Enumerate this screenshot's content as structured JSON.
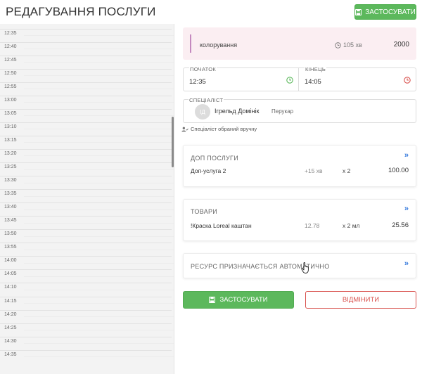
{
  "header": {
    "title": "РЕДАГУВАННЯ ПОСЛУГИ",
    "apply_label": "ЗАСТОСУВАТИ"
  },
  "timeline": {
    "times": [
      "12:35",
      "12:40",
      "12:45",
      "12:50",
      "12:55",
      "13:00",
      "13:05",
      "13:10",
      "13:15",
      "13:20",
      "13:25",
      "13:30",
      "13:35",
      "13:40",
      "13:45",
      "13:50",
      "13:55",
      "14:00",
      "14:05",
      "14:10",
      "14:15",
      "14:20",
      "14:25",
      "14:30",
      "14:35"
    ]
  },
  "service": {
    "name": "колорування",
    "duration": "105 хв",
    "price": "2000",
    "accent_color": "#c489bf"
  },
  "time": {
    "start_label": "ПОЧАТОК",
    "start_value": "12:35",
    "end_label": "КІНЕЦЬ",
    "end_value": "14:05",
    "start_icon_color": "#5cb85c",
    "end_icon_color": "#d9534f"
  },
  "specialist": {
    "caption": "СПЕЦІАЛІСТ",
    "initials": "ІД",
    "name": "Ігрельд Домінік",
    "role": "Перукар",
    "note": "Спеціаліст обраний вручну"
  },
  "extras": {
    "title": "ДОП ПОСЛУГИ",
    "items": [
      {
        "name": "Доп-услуга 2",
        "duration": "+15 хв",
        "qty": "х 2",
        "price": "100.00"
      }
    ]
  },
  "goods": {
    "title": "ТОВАРИ",
    "items": [
      {
        "name": "!Краска Loreal каштан",
        "unit_price": "12.78",
        "qty": "х 2 мл",
        "price": "25.56"
      }
    ]
  },
  "resource": {
    "title": "РЕСУРС ПРИЗНАЧАЄТЬСЯ АВТОМАТИЧНО"
  },
  "actions": {
    "apply_label": "ЗАСТОСУВАТИ",
    "cancel_label": "ВІДМІНИТИ"
  },
  "colors": {
    "primary_green": "#5cb85c",
    "danger_red": "#d9534f",
    "link_blue": "#3b7ddd",
    "service_bg": "#fbeef2"
  }
}
